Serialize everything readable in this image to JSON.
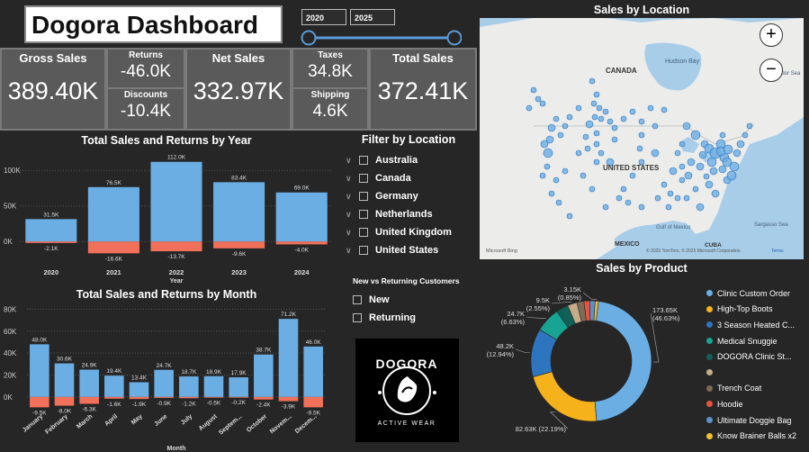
{
  "header": {
    "title": "Dogora Dashboard"
  },
  "date_range": {
    "start": "2020",
    "end": "2025"
  },
  "kpis": {
    "gross_sales": {
      "label": "Gross Sales",
      "value": "389.40K"
    },
    "returns": {
      "label": "Returns",
      "value": "-46.0K"
    },
    "discounts": {
      "label": "Discounts",
      "value": "-10.4K"
    },
    "net_sales": {
      "label": "Net Sales",
      "value": "332.97K"
    },
    "taxes": {
      "label": "Taxes",
      "value": "34.8K"
    },
    "shipping": {
      "label": "Shipping",
      "value": "4.6K"
    },
    "total_sales": {
      "label": "Total Sales",
      "value": "372.41K"
    }
  },
  "filter_location": {
    "title": "Filter by Location",
    "items": [
      "Australia",
      "Canada",
      "Germany",
      "Netherlands",
      "United Kingdom",
      "United States"
    ]
  },
  "customer_filter": {
    "title": "New vs Returning Customers",
    "items": [
      "New",
      "Returning"
    ]
  },
  "logo": {
    "brand": "DOGORA",
    "tagline": "ACTIVE WEAR"
  },
  "map": {
    "title": "Sales by Location",
    "labels": {
      "canada": "CANADA",
      "us": "UNITED STATES",
      "mexico": "MEXICO",
      "cuba": "CUBA",
      "hudson": "Hudson Bay",
      "labrador": "Labrador Sea",
      "sargasso": "Sargasso Sea",
      "gulf": "Gulf of Mexico"
    },
    "attribution": "Microsoft Bing",
    "copyright": "© 2025 TomTom, © 2025 Microsoft Corporation",
    "terms": "Terms",
    "zoom_in": "+",
    "zoom_out": "−"
  },
  "chart_data": [
    {
      "type": "bar",
      "title": "Total Sales and Returns by Year",
      "xlabel": "Year",
      "categories": [
        "2020",
        "2021",
        "2022",
        "2023",
        "2024"
      ],
      "series": [
        {
          "name": "Total Sales",
          "values": [
            31.5,
            76.5,
            112.0,
            83.4,
            69.0
          ],
          "labels": [
            "31.5K",
            "76.5K",
            "112.0K",
            "83.4K",
            "69.0K"
          ],
          "color": "#6aaee3"
        },
        {
          "name": "Returns",
          "values": [
            -2.1,
            -16.6,
            -13.7,
            -9.6,
            -4.0
          ],
          "labels": [
            "-2.1K",
            "-16.6K",
            "-13.7K",
            "-9.6K",
            "-4.0K"
          ],
          "color": "#f0705a"
        }
      ],
      "yticks": [
        "0K",
        "50K",
        "100K"
      ],
      "ylim": [
        -25,
        118
      ]
    },
    {
      "type": "bar",
      "title": "Total Sales and Returns by Month",
      "xlabel": "Month",
      "categories": [
        "January",
        "February",
        "March",
        "April",
        "May",
        "June",
        "July",
        "August",
        "Septem...",
        "October",
        "Novem...",
        "Decem..."
      ],
      "series": [
        {
          "name": "Total Sales",
          "values": [
            48.0,
            30.6,
            24.9,
            19.4,
            13.4,
            24.7,
            18.7,
            18.9,
            17.9,
            38.7,
            71.2,
            46.0
          ],
          "labels": [
            "48.0K",
            "30.6K",
            "24.9K",
            "19.4K",
            "13.4K",
            "24.7K",
            "18.7K",
            "18.9K",
            "17.9K",
            "38.7K",
            "71.2K",
            "46.0K"
          ],
          "color": "#6aaee3"
        },
        {
          "name": "Returns",
          "values": [
            -9.5,
            -8.0,
            -6.3,
            -1.6,
            -1.9,
            -0.9,
            -1.2,
            -0.5,
            -0.2,
            -2.4,
            -3.9,
            -9.5
          ],
          "labels": [
            "-9.5K",
            "-8.0K",
            "-6.3K",
            "-1.6K",
            "-1.9K",
            "-0.9K",
            "-1.2K",
            "-0.5K",
            "-0.2K",
            "-2.4K",
            "-3.9K",
            "-9.5K"
          ],
          "color": "#f0705a"
        }
      ],
      "yticks": [
        "0K",
        "20K",
        "40K",
        "60K",
        "80K"
      ],
      "ylim": [
        -10,
        82
      ]
    },
    {
      "type": "pie",
      "title": "Sales by Product",
      "slices": [
        {
          "name": "Clinic Custom Order",
          "value": 173.65,
          "label": "173.65K (46.63%)",
          "color": "#6aaee3"
        },
        {
          "name": "High-Top Boots",
          "value": 82.63,
          "label": "82.63K (22.19%)",
          "color": "#f6b21b"
        },
        {
          "name": "3 Season Heated C...",
          "value": 48.2,
          "label": "48.2K (12.94%)",
          "color": "#2e75c0"
        },
        {
          "name": "Medical Snuggie",
          "value": 24.7,
          "label": "24.7K (6.63%)",
          "color": "#18a393"
        },
        {
          "name": "DOGORA Clinic St...",
          "value": 12.1,
          "label": "",
          "color": "#106158"
        },
        {
          "name": "",
          "value": 9.5,
          "label": "9.5K (2.55%)",
          "color": "#c6ad8a"
        },
        {
          "name": "Trench Coat",
          "value": 7.0,
          "label": "",
          "color": "#7d6b55"
        },
        {
          "name": "Hoodie",
          "value": 5.7,
          "label": "",
          "color": "#e8533f"
        },
        {
          "name": "Ultimate Doggie Bag",
          "value": 5.5,
          "label": "",
          "color": "#5d8fc9"
        },
        {
          "name": "Know Brainer Balls x2",
          "value": 3.15,
          "label": "3.15K (0.85%)",
          "color": "#f6c02e"
        }
      ]
    }
  ]
}
